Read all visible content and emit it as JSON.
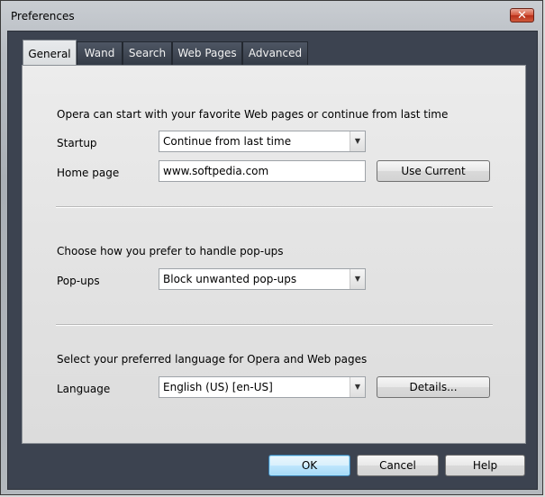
{
  "window": {
    "title": "Preferences",
    "close_glyph": "✕"
  },
  "tabs": [
    {
      "label": "General"
    },
    {
      "label": "Wand"
    },
    {
      "label": "Search"
    },
    {
      "label": "Web Pages"
    },
    {
      "label": "Advanced"
    }
  ],
  "startup_section": {
    "heading": "Opera can start with your favorite Web pages or continue from last time",
    "startup_label": "Startup",
    "startup_value": "Continue from last time",
    "homepage_label": "Home page",
    "homepage_value": "www.softpedia.com",
    "use_current_label": "Use Current"
  },
  "popups_section": {
    "heading": "Choose how you prefer to handle pop-ups",
    "popups_label": "Pop-ups",
    "popups_value": "Block unwanted pop-ups"
  },
  "language_section": {
    "heading": "Select your preferred language for Opera and Web pages",
    "language_label": "Language",
    "language_value": "English (US) [en-US]",
    "details_label": "Details..."
  },
  "footer": {
    "ok_label": "OK",
    "cancel_label": "Cancel",
    "help_label": "Help"
  }
}
